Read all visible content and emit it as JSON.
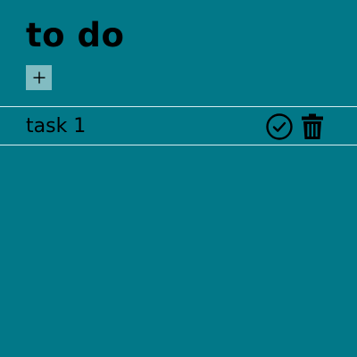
{
  "header": {
    "title": "to do"
  },
  "toolbar": {
    "add_icon": "plus-icon"
  },
  "tasks": [
    {
      "label": "task 1",
      "complete_icon": "check-circle-icon",
      "delete_icon": "trash-icon"
    }
  ],
  "colors": {
    "background": "#027888",
    "add_button_bg": "#82bcc2",
    "divider": "#d7eef1",
    "text": "#000000"
  }
}
